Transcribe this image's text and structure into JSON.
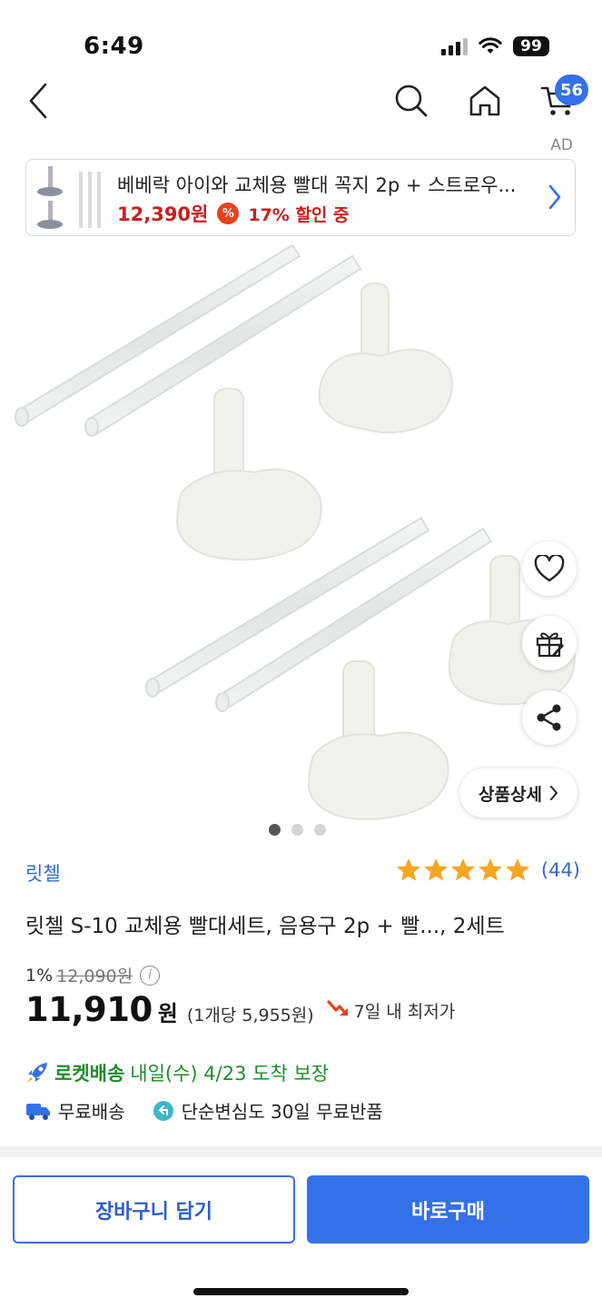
{
  "status_bar": {
    "time": "6:49",
    "battery": "99"
  },
  "nav": {
    "cart_count": "56"
  },
  "ad": {
    "label": "AD",
    "title": "베베락 아이와 교체용 빨대 꼭지 2p + 스트로우...",
    "price": "12,390원",
    "discount": "17% 할인 중",
    "discount_icon": "%"
  },
  "product": {
    "brand": "릿첼",
    "rating_count": "(44)",
    "title": "릿첼 S-10 교체용 빨대세트, 음용구 2p + 빨..., 2세트",
    "discount_rate": "1%",
    "original_price": "12,090원",
    "price": "11,910",
    "price_unit": "원",
    "unit_price": "(1개당 5,955원)",
    "lowest_price": "7일 내 최저가",
    "detail_button": "상품상세",
    "image_count": 3,
    "image_index": 1
  },
  "shipping": {
    "rocket_label": "로켓배송",
    "rocket_date": "내일(수) 4/23 도착 보장",
    "free_shipping": "무료배송",
    "free_return": "단순변심도 30일 무료반품"
  },
  "buttons": {
    "add_to_cart": "장바구니 담기",
    "buy_now": "바로구매"
  },
  "colors": {
    "accent": "#3471e8",
    "price_red": "#c8201f",
    "rocket_green": "#1e8d2b",
    "star": "#f5a623",
    "link_blue": "#3867c8"
  }
}
